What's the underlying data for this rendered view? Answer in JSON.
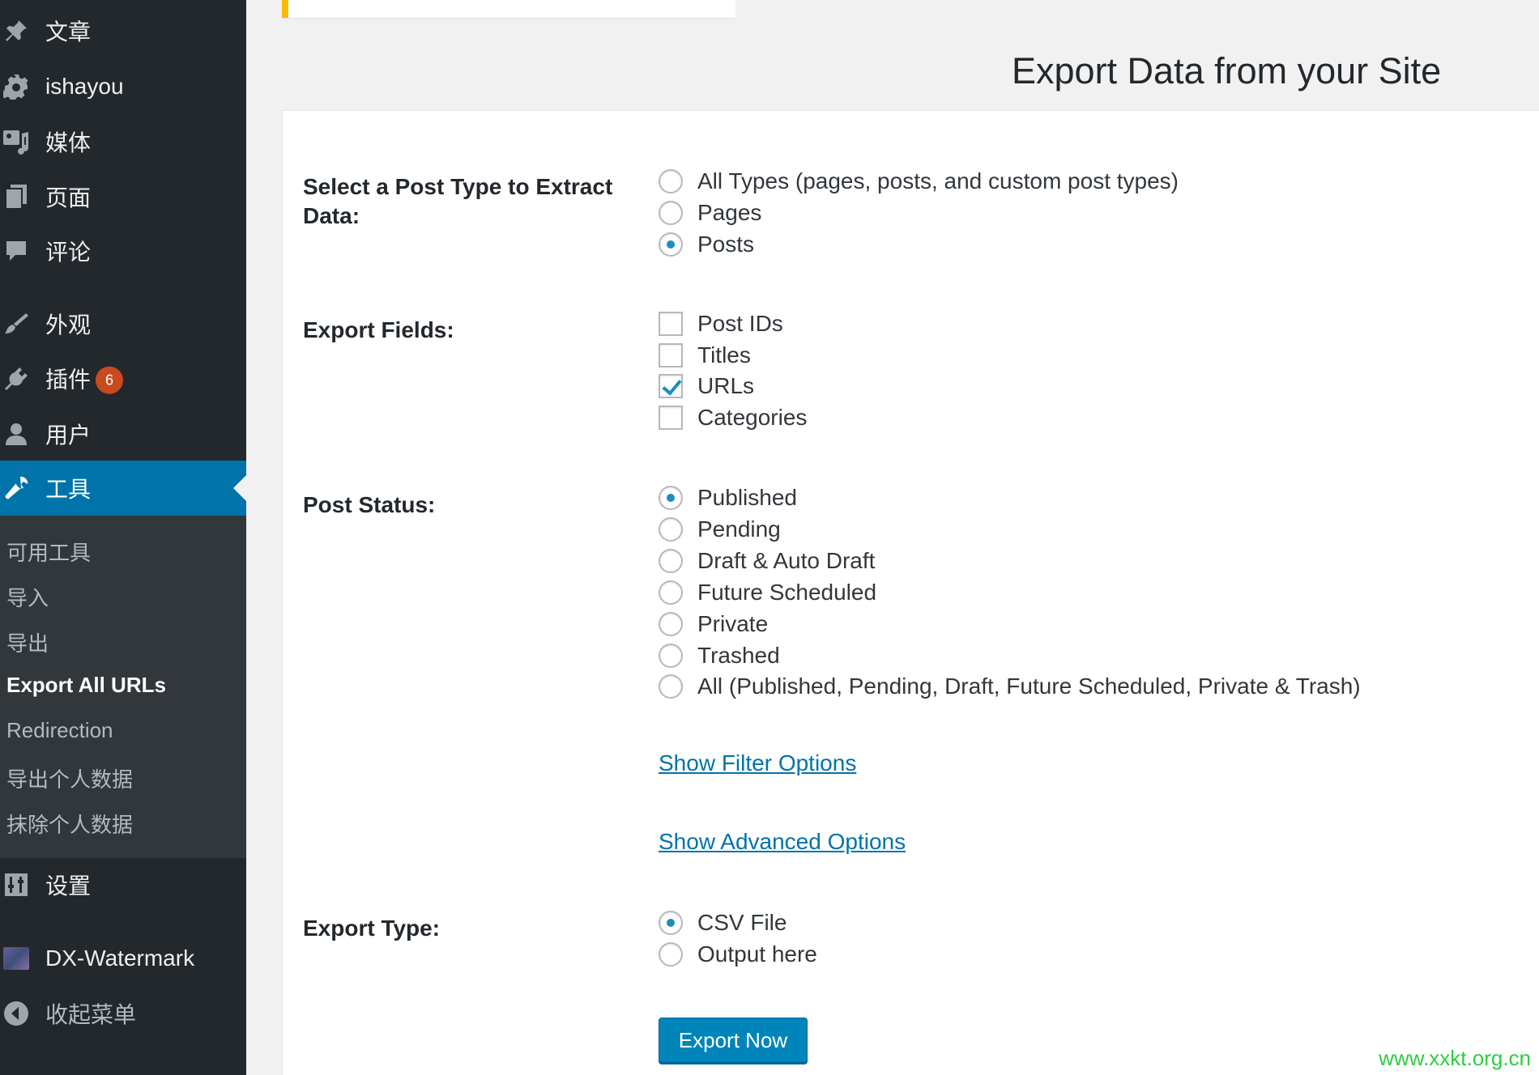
{
  "sidebar": {
    "items": [
      {
        "label": "文章",
        "icon": "pushpin-icon"
      },
      {
        "label": "ishayou",
        "icon": "gear-icon"
      },
      {
        "label": "媒体",
        "icon": "media-icon"
      },
      {
        "label": "页面",
        "icon": "page-icon"
      },
      {
        "label": "评论",
        "icon": "comment-icon"
      },
      {
        "label": "外观",
        "icon": "paintbrush-icon"
      },
      {
        "label": "插件",
        "icon": "plugin-icon",
        "badge": "6"
      },
      {
        "label": "用户",
        "icon": "user-icon"
      },
      {
        "label": "工具",
        "icon": "wrench-icon",
        "active": true
      },
      {
        "label": "设置",
        "icon": "settings-sliders-icon"
      },
      {
        "label": "DX-Watermark",
        "icon": "watermark-thumbnail-icon"
      },
      {
        "label": "收起菜单",
        "icon": "collapse-arrow-icon"
      }
    ],
    "submenu": [
      {
        "label": "可用工具"
      },
      {
        "label": "导入"
      },
      {
        "label": "导出"
      },
      {
        "label": "Export All URLs",
        "current": true
      },
      {
        "label": "Redirection"
      },
      {
        "label": "导出个人数据"
      },
      {
        "label": "抹除个人数据"
      }
    ]
  },
  "page": {
    "title": "Export Data from your Site"
  },
  "form": {
    "post_type": {
      "label": "Select a Post Type to Extract Data:",
      "options": [
        {
          "label": "All Types (pages, posts, and custom post types)",
          "checked": false
        },
        {
          "label": "Pages",
          "checked": false
        },
        {
          "label": "Posts",
          "checked": true
        }
      ]
    },
    "export_fields": {
      "label": "Export Fields:",
      "options": [
        {
          "label": "Post IDs",
          "checked": false
        },
        {
          "label": "Titles",
          "checked": false
        },
        {
          "label": "URLs",
          "checked": true
        },
        {
          "label": "Categories",
          "checked": false
        }
      ]
    },
    "post_status": {
      "label": "Post Status:",
      "options": [
        {
          "label": "Published",
          "checked": true
        },
        {
          "label": "Pending",
          "checked": false
        },
        {
          "label": "Draft & Auto Draft",
          "checked": false
        },
        {
          "label": "Future Scheduled",
          "checked": false
        },
        {
          "label": "Private",
          "checked": false
        },
        {
          "label": "Trashed",
          "checked": false
        },
        {
          "label": "All (Published, Pending, Draft, Future Scheduled, Private & Trash)",
          "checked": false
        }
      ]
    },
    "filter_link": "Show Filter Options",
    "advanced_link": "Show Advanced Options",
    "export_type": {
      "label": "Export Type:",
      "options": [
        {
          "label": "CSV File",
          "checked": true
        },
        {
          "label": "Output here",
          "checked": false
        }
      ]
    },
    "submit_label": "Export Now"
  },
  "watermark_text": "www.xxkt.org.cn",
  "colors": {
    "sidebar_bg": "#23282d",
    "submenu_bg": "#32373c",
    "accent": "#0073aa",
    "button": "#0085ba",
    "badge": "#ca4a1f",
    "watermark": "#2ecc40"
  }
}
